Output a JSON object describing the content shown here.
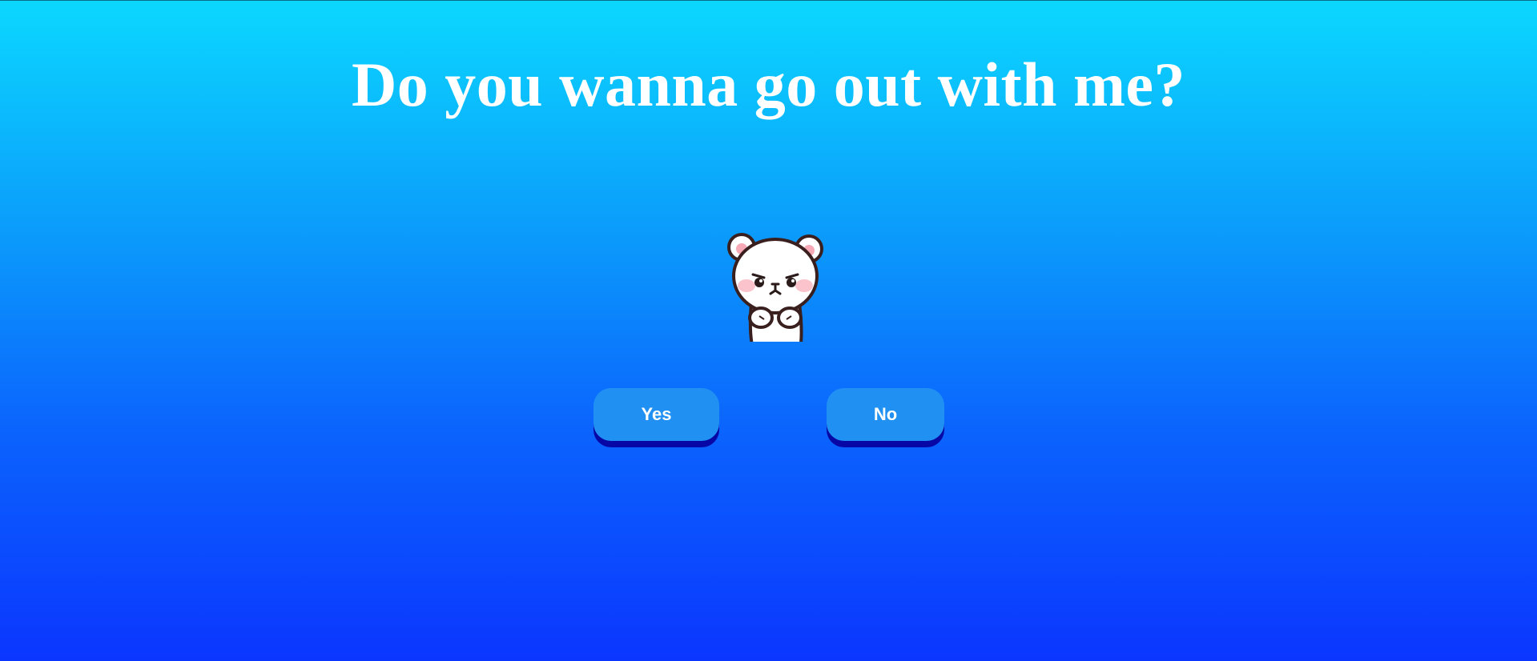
{
  "page": {
    "title": "Do you wanna go out with me?"
  },
  "buttons": {
    "yes_label": "Yes",
    "no_label": "No"
  },
  "illustration": {
    "icon": "bear-icon"
  },
  "colors": {
    "gradient_top": "#0bd8fe",
    "gradient_bottom": "#0b36fe",
    "button_bg": "#2190f3",
    "button_shadow": "#0707a6",
    "text": "#ffffff"
  }
}
